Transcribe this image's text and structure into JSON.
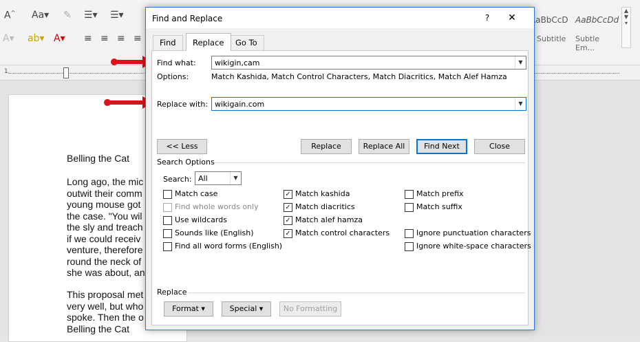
{
  "ribbon": {
    "font_row1": [
      "A",
      "Aa",
      "A",
      "A"
    ],
    "styles": [
      {
        "preview": "AaBbCcD",
        "name": "Subtitle"
      },
      {
        "preview": "AaBbCcDd",
        "name": "Subtle Em..."
      }
    ]
  },
  "document": {
    "lines_block1": [
      "Belling the Cat"
    ],
    "lines_block2": [
      "Long ago, the mic",
      "outwit their comm",
      "young mouse got",
      "the case. \"You wil",
      "the sly and treach",
      "if we could receiv",
      "venture, therefore",
      "round the neck of",
      "she was about, an"
    ],
    "lines_block3": [
      "This proposal met",
      "very well, but who",
      "spoke. Then the o",
      "Belling the Cat"
    ]
  },
  "dialog": {
    "title": "Find and Replace",
    "help": "?",
    "close": "✕",
    "tabs": [
      {
        "label": "Find"
      },
      {
        "label": "Replace"
      },
      {
        "label": "Go To"
      }
    ],
    "find_label": "Find what:",
    "find_value": "wikigin,cam",
    "options_label": "Options:",
    "options_value": "Match Kashida, Match Control Characters, Match Diacritics, Match Alef Hamza",
    "replace_label": "Replace with:",
    "replace_value": "wikigain.com",
    "buttons": {
      "less": "<< Less",
      "replace": "Replace",
      "replace_all": "Replace All",
      "find_next": "Find Next",
      "close": "Close"
    },
    "search_options_label": "Search Options",
    "search_label": "Search:",
    "search_value": "All",
    "col1": [
      {
        "label": "Match case",
        "checked": false,
        "disabled": false
      },
      {
        "label": "Find whole words only",
        "checked": false,
        "disabled": true
      },
      {
        "label": "Use wildcards",
        "checked": false,
        "disabled": false
      },
      {
        "label": "Sounds like (English)",
        "checked": false,
        "disabled": false
      },
      {
        "label": "Find all word forms (English)",
        "checked": false,
        "disabled": false
      }
    ],
    "col2": [
      {
        "label": "Match kashida",
        "checked": true
      },
      {
        "label": "Match diacritics",
        "checked": true
      },
      {
        "label": "Match alef hamza",
        "checked": true
      },
      {
        "label": "Match control characters",
        "checked": true
      }
    ],
    "col3": [
      {
        "label": "Match prefix",
        "checked": false
      },
      {
        "label": "Match suffix",
        "checked": false
      },
      {
        "label": "Ignore punctuation characters",
        "checked": false
      },
      {
        "label": "Ignore white-space characters",
        "checked": false
      }
    ],
    "replace_section_label": "Replace",
    "format_label": "Format",
    "special_label": "Special",
    "no_formatting_label": "No Formatting"
  },
  "colors": {
    "accent": "#0078d7",
    "arrow": "#e0101a",
    "title_border": "#2b79d5"
  }
}
